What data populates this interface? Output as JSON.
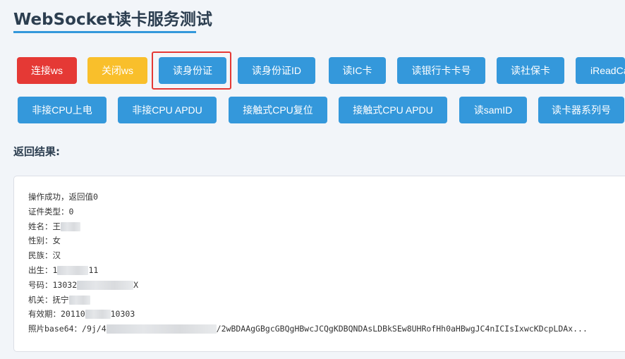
{
  "page": {
    "title": "WebSocket读卡服务测试"
  },
  "colors": {
    "accent": "#3498db",
    "danger": "#e53935",
    "warning": "#f9bf2b",
    "highlight": "#e53935"
  },
  "buttons": {
    "row1": [
      {
        "label": "连接ws",
        "style": "red"
      },
      {
        "label": "关闭ws",
        "style": "yellow"
      },
      {
        "label": "读身份证",
        "style": "blue",
        "highlighted": true
      },
      {
        "label": "读身份证ID",
        "style": "blue"
      },
      {
        "label": "读IC卡",
        "style": "blue"
      },
      {
        "label": "读银行卡卡号",
        "style": "blue"
      },
      {
        "label": "读社保卡",
        "style": "blue"
      },
      {
        "label": "iReadCa",
        "style": "blue"
      }
    ],
    "row2": [
      {
        "label": "非接CPU上电",
        "style": "blue"
      },
      {
        "label": "非接CPU APDU",
        "style": "blue"
      },
      {
        "label": "接触式CPU复位",
        "style": "blue"
      },
      {
        "label": "接触式CPU APDU",
        "style": "blue"
      },
      {
        "label": "读samID",
        "style": "blue"
      },
      {
        "label": "读卡器系列号",
        "style": "blue"
      }
    ]
  },
  "result": {
    "label": "返回结果:",
    "lines": [
      {
        "prefix": "操作成功，返回值0",
        "suffix": ""
      },
      {
        "prefix": "证件类型：0",
        "suffix": ""
      },
      {
        "prefix": "姓名：王",
        "suffix": ""
      },
      {
        "prefix": "性别：女",
        "suffix": ""
      },
      {
        "prefix": "民族：汉",
        "suffix": ""
      },
      {
        "prefix": "出生：1",
        "suffix": "11"
      },
      {
        "prefix": "号码：13032",
        "suffix": "X"
      },
      {
        "prefix": "机关：抚宁",
        "suffix": ""
      },
      {
        "prefix": "有效期：20110",
        "suffix": "10303"
      },
      {
        "prefix": "照片base64：/9j/4",
        "suffix": "/2wBDAAgGBgcGBQgHBwcJCQgKDBQNDAsLDBkSEw8UHRofHh0aHBwgJC4nICIsIxwcKDcpLDAx..."
      }
    ]
  }
}
